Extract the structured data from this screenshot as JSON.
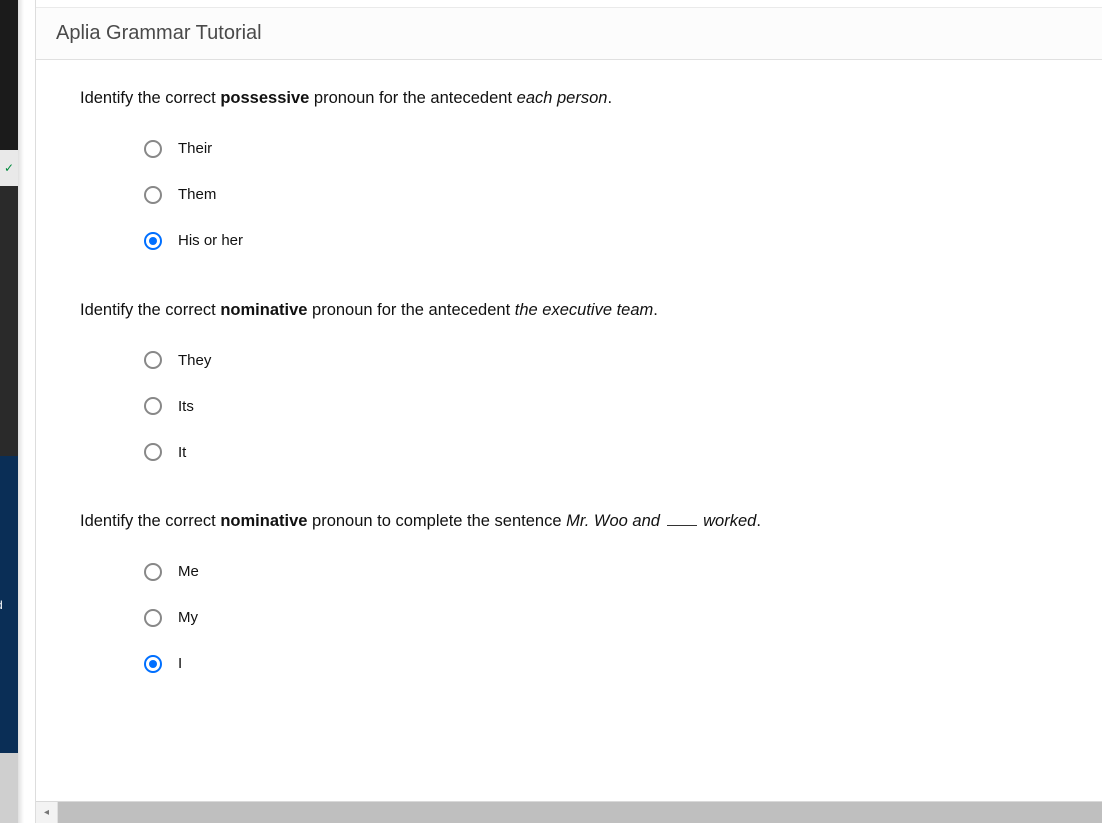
{
  "sidebar": {
    "check_glyph": "✓",
    "blue_text": "d"
  },
  "page": {
    "title": "Aplia Grammar Tutorial"
  },
  "questions": [
    {
      "prompt_pre": "Identify the correct ",
      "prompt_bold": "possessive",
      "prompt_mid": " pronoun for the antecedent ",
      "prompt_ital": "each person",
      "prompt_post": ".",
      "has_blank": false,
      "options": [
        {
          "label": "Their",
          "selected": false
        },
        {
          "label": "Them",
          "selected": false
        },
        {
          "label": "His or her",
          "selected": true
        }
      ]
    },
    {
      "prompt_pre": "Identify the correct ",
      "prompt_bold": "nominative",
      "prompt_mid": " pronoun for the antecedent ",
      "prompt_ital": "the executive team",
      "prompt_post": ".",
      "has_blank": false,
      "options": [
        {
          "label": "They",
          "selected": false
        },
        {
          "label": "Its",
          "selected": false
        },
        {
          "label": "It",
          "selected": false
        }
      ]
    },
    {
      "prompt_pre": "Identify the correct ",
      "prompt_bold": "nominative",
      "prompt_mid": " pronoun to complete the sentence ",
      "prompt_ital": "Mr. Woo and ",
      "prompt_ital2": " worked",
      "prompt_post": ".",
      "has_blank": true,
      "options": [
        {
          "label": "Me",
          "selected": false
        },
        {
          "label": "My",
          "selected": false
        },
        {
          "label": "I",
          "selected": true
        }
      ]
    }
  ]
}
